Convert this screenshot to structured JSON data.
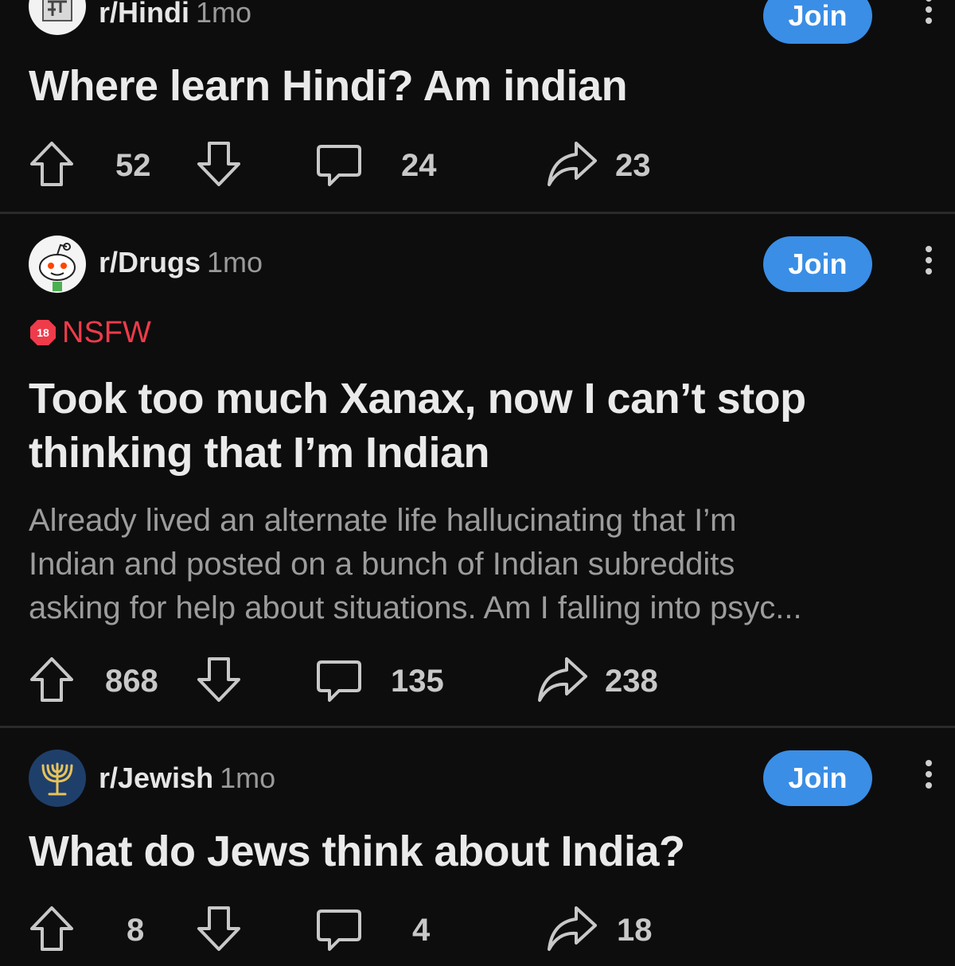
{
  "colors": {
    "background": "#0d0d0d",
    "join_button": "#3a8ee6",
    "nsfw": "#ef3b4a",
    "title_text": "#eaeaea",
    "body_text": "#9c9c9c",
    "meta_text": "#9a9a9a"
  },
  "posts": [
    {
      "subreddit": "r/Hindi",
      "age": "1mo",
      "avatar_icon": "hindi-letter-icon",
      "join_label": "Join",
      "title": "Where learn Hindi? Am indian",
      "upvotes": "52",
      "comments": "24",
      "shares": "23"
    },
    {
      "subreddit": "r/Drugs",
      "age": "1mo",
      "avatar_icon": "snoo-icon",
      "join_label": "Join",
      "nsfw_badge": "18",
      "nsfw_label": "NSFW",
      "title_line1": "Took too much Xanax, now I can’t stop",
      "title_line2": "thinking that I’m Indian",
      "body_line1": "Already lived an alternate life hallucinating that I’m",
      "body_line2": "Indian and posted on a bunch of Indian subreddits",
      "body_line3": "asking for help about situations. Am I falling into psyc...",
      "upvotes": "868",
      "comments": "135",
      "shares": "238"
    },
    {
      "subreddit": "r/Jewish",
      "age": "1mo",
      "avatar_icon": "menorah-icon",
      "join_label": "Join",
      "title": "What do Jews think about India?",
      "upvotes": "8",
      "comments": "4",
      "shares": "18"
    }
  ]
}
